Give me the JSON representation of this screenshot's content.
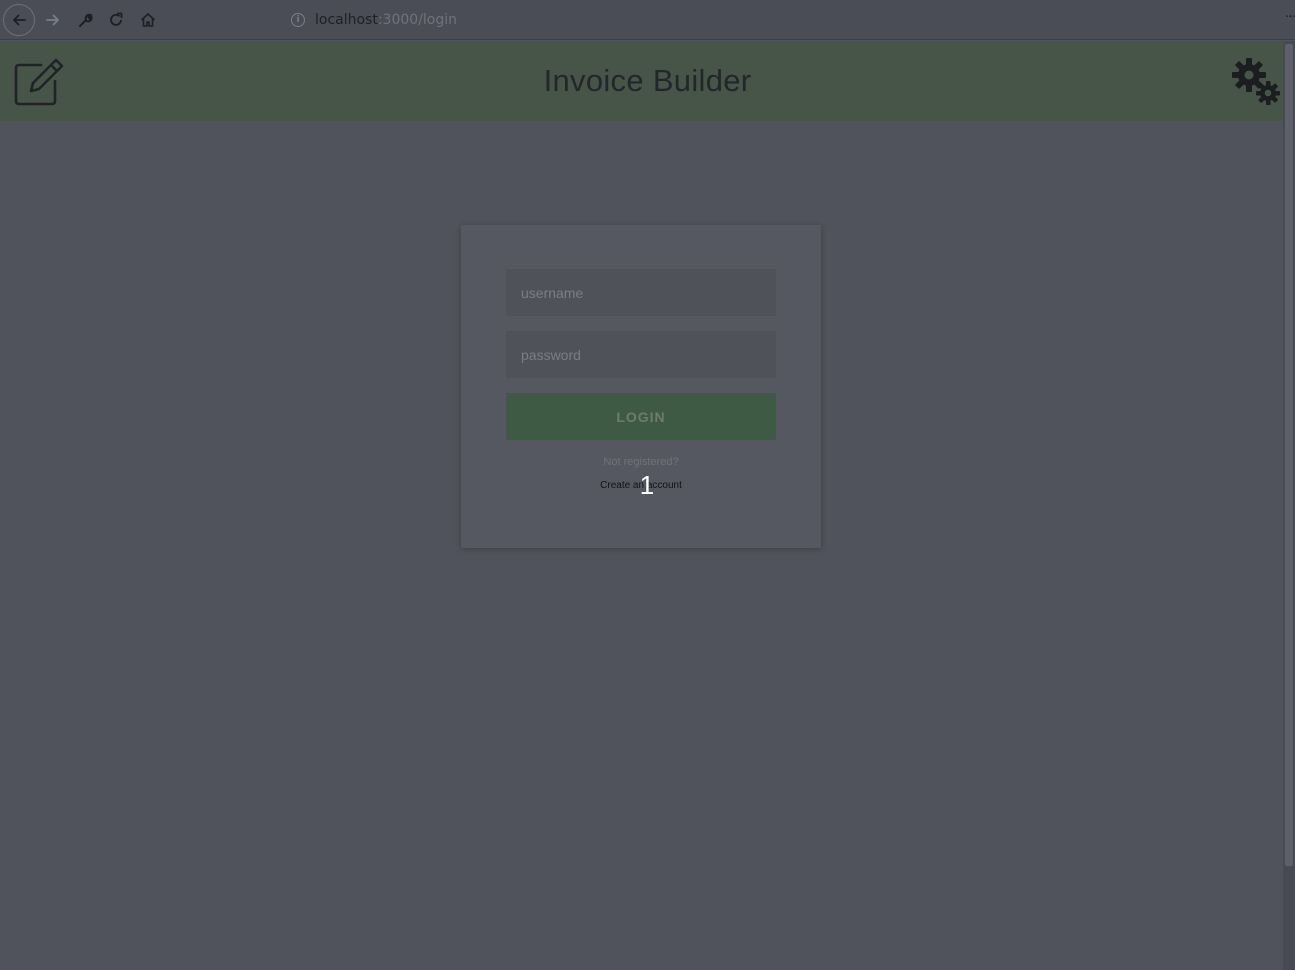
{
  "browser": {
    "url_host": "localhost",
    "url_path": ":3000/login",
    "url_info_glyph": "i",
    "more_glyph": "···",
    "icons": [
      "back-arrow-icon",
      "forward-arrow-icon",
      "wrench-icon",
      "reload-icon",
      "home-icon",
      "info-icon"
    ]
  },
  "header": {
    "title": "Invoice Builder",
    "left_icon": "edit-icon",
    "right_icon": "gears-icon",
    "background": "#475448"
  },
  "login": {
    "username_placeholder": "username",
    "password_placeholder": "password",
    "button_label": "LOGIN",
    "not_registered": "Not registered?",
    "create_account": "Create an account",
    "button_color": "#3f5a44"
  },
  "overlay": {
    "step_label": "1"
  }
}
